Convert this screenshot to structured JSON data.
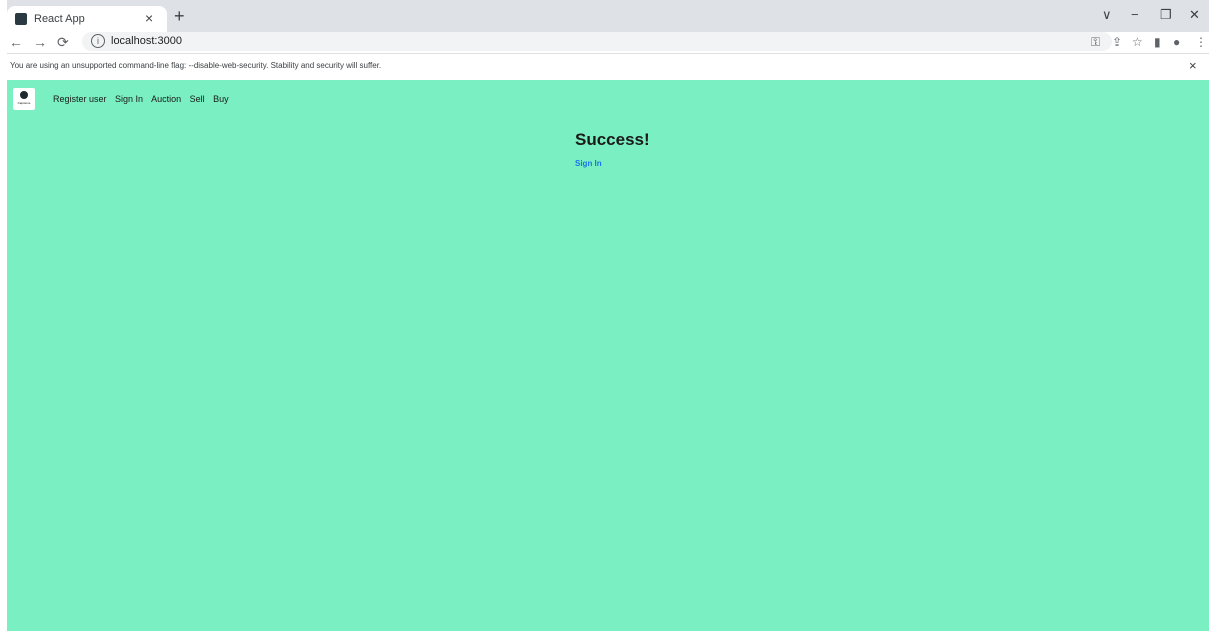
{
  "browser": {
    "tab_title": "React App",
    "tab_close": "×",
    "new_tab": "+",
    "url": "localhost:3000",
    "window_controls": [
      "∨",
      "−",
      "❐",
      "✕"
    ]
  },
  "infobar": {
    "message": "You are using an unsupported command-line flag: --disable-web-security. Stability and security will suffer.",
    "close": "×"
  },
  "app": {
    "logo_caption": "Capstone",
    "nav": [
      "Register user",
      "Sign In",
      "Auction",
      "Sell",
      "Buy"
    ],
    "heading": "Success!",
    "link": "Sign In"
  },
  "colors": {
    "page_background": "#79efc2",
    "link": "#1a73e8"
  }
}
